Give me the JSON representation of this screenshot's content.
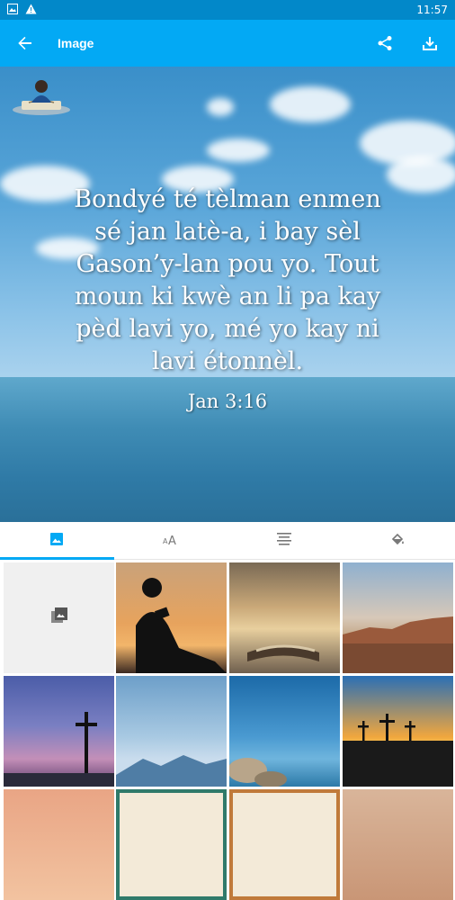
{
  "status_bar": {
    "time": "11:57",
    "icons": [
      "image-icon",
      "warning-icon"
    ]
  },
  "app_bar": {
    "title": "Image",
    "back_icon": "arrow-back-icon",
    "share_icon": "share-icon",
    "download_icon": "download-icon"
  },
  "preview": {
    "verse_lines": [
      "Bondyé té tèlman enmen",
      "sé jan latè-a, i bay sèl",
      "Gason’y-lan pou yo. Tout",
      "moun ki kwè an li pa kay",
      "pèd lavi yo, mé yo kay ni",
      "lavi étonnèl."
    ],
    "reference": "Jan 3:16"
  },
  "tabs": [
    {
      "name": "tab-background",
      "icon": "image-icon",
      "active": true
    },
    {
      "name": "tab-font",
      "icon": "font-size-icon",
      "active": false
    },
    {
      "name": "tab-align",
      "icon": "text-align-icon",
      "active": false
    },
    {
      "name": "tab-color",
      "icon": "paint-bucket-icon",
      "active": false
    }
  ],
  "backgrounds": [
    {
      "name": "gallery-picker",
      "icon": "gallery-icon"
    },
    {
      "name": "bg-boy-reading-sunset"
    },
    {
      "name": "bg-open-bible-sunset"
    },
    {
      "name": "bg-canyon-dusk"
    },
    {
      "name": "bg-cross-purple-sky"
    },
    {
      "name": "bg-blue-mountains"
    },
    {
      "name": "bg-rocky-lake"
    },
    {
      "name": "bg-three-crosses-sunset"
    },
    {
      "name": "bg-pink-sky"
    },
    {
      "name": "bg-ornate-frame-1"
    },
    {
      "name": "bg-ornate-frame-2"
    },
    {
      "name": "bg-sand-dune"
    }
  ],
  "colors": {
    "primary": "#03a9f4",
    "status_bar": "#0288c9"
  }
}
